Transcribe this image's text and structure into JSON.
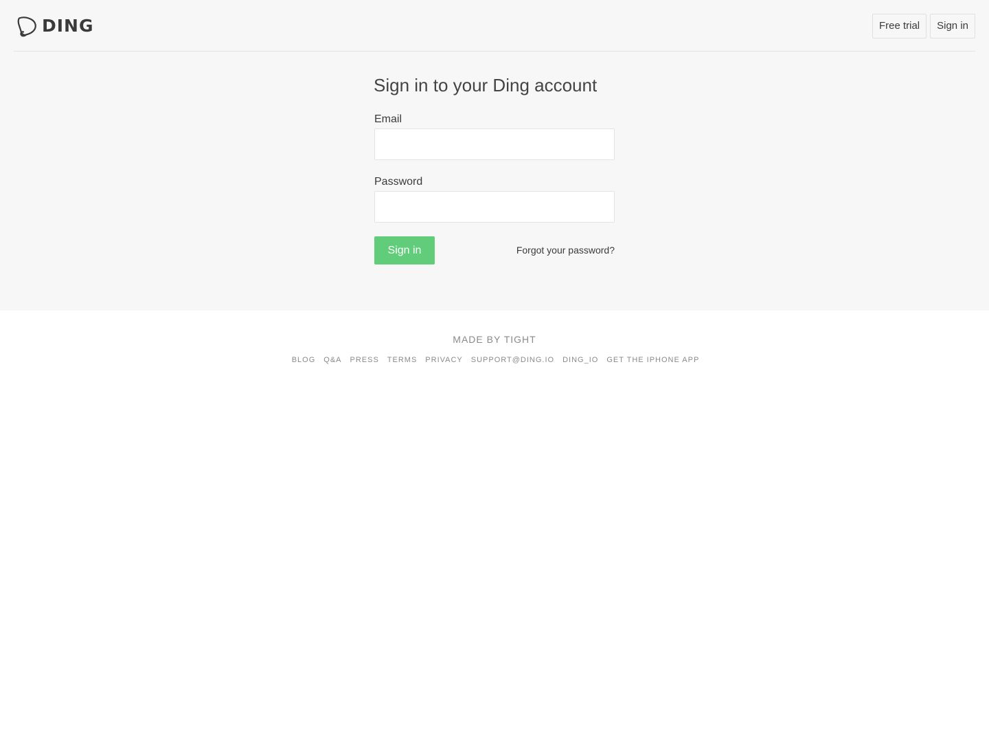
{
  "header": {
    "logo_text": "DING",
    "logo_icon": "bell-tag-icon",
    "nav": {
      "free_trial_label": "Free trial",
      "sign_in_label": "Sign in"
    }
  },
  "form": {
    "title": "Sign in to your Ding account",
    "email_label": "Email",
    "email_value": "",
    "password_label": "Password",
    "password_value": "",
    "submit_label": "Sign in",
    "forgot_label": "Forgot your password?"
  },
  "footer": {
    "made_by": "MADE BY TIGHT",
    "links": [
      "BLOG",
      "Q&A",
      "PRESS",
      "TERMS",
      "PRIVACY",
      "SUPPORT@DING.IO",
      "DING_IO",
      "GET THE IPHONE APP"
    ]
  },
  "colors": {
    "top_background": "#f7f7f7",
    "page_background": "#ffffff",
    "accent_green": "#61cd7b",
    "text_dark": "#3a3a3a",
    "text_muted": "#8a8a8a",
    "border": "#e3e3e3"
  }
}
